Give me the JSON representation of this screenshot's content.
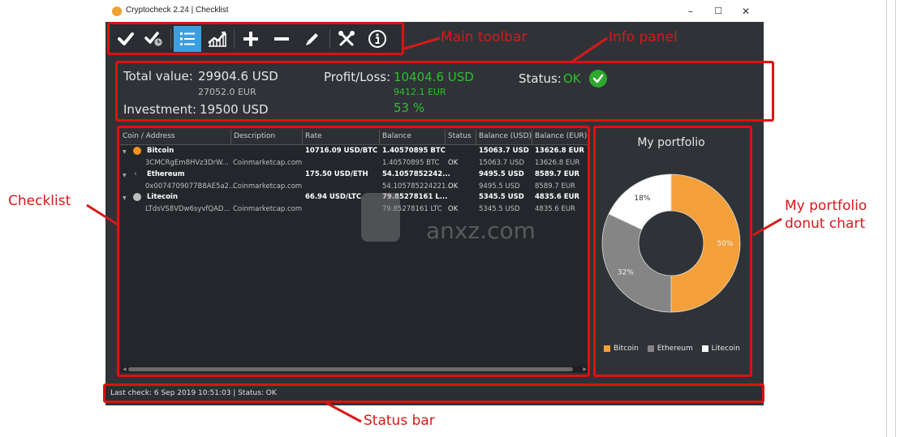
{
  "window": {
    "title": "Cryptocheck 2.24 | Checklist",
    "controls": {
      "minimize": "–",
      "maximize": "☐",
      "close": "✕"
    }
  },
  "toolbar": {
    "buttons": [
      {
        "name": "check",
        "icon": "checkmark-icon",
        "active": false
      },
      {
        "name": "scheduled-check",
        "icon": "check-clock-icon",
        "active": false
      },
      {
        "name": "checklist",
        "icon": "list-icon",
        "active": true
      },
      {
        "name": "chart",
        "icon": "chart-growth-icon",
        "active": false
      },
      {
        "name": "add",
        "icon": "plus-icon",
        "active": false
      },
      {
        "name": "remove",
        "icon": "minus-icon",
        "active": false
      },
      {
        "name": "edit",
        "icon": "pencil-icon",
        "active": false
      },
      {
        "name": "settings",
        "icon": "tools-icon",
        "active": false
      },
      {
        "name": "about",
        "icon": "info-icon",
        "active": false
      }
    ]
  },
  "info_panel": {
    "total_value_label": "Total value:",
    "total_value_usd": "29904.6 USD",
    "total_value_eur": "27052.0 EUR",
    "investment_label": "Investment:",
    "investment_value": "19500 USD",
    "profit_label": "Profit/Loss:",
    "profit_usd": "10404.6 USD",
    "profit_eur": "9412.1 EUR",
    "profit_percent": "53 %",
    "status_label": "Status:",
    "status_value": "OK"
  },
  "checklist": {
    "columns": [
      "Coin / Address",
      "Description",
      "Rate",
      "Balance",
      "Status",
      "Balance (USD)",
      "Balance (EUR)"
    ],
    "rows": [
      {
        "coin": "Bitcoin",
        "icon": "bitcoin-icon",
        "color": "#f7931a",
        "address": "3CMCRgEm8HVz3DrW...",
        "description": "Coinmarketcap.com",
        "rate": "10716.09 USD/BTC",
        "balance": "1.40570895 BTC",
        "balance_sub": "1.40570895 BTC",
        "status": "OK",
        "usd": "15063.7 USD",
        "usd_sub": "15063.7 USD",
        "eur": "13626.8 EUR",
        "eur_sub": "13626.8 EUR"
      },
      {
        "coin": "Ethereum",
        "icon": "ethereum-icon",
        "color": "#8c8c8c",
        "address": "0x0074709077B8AE5a2...",
        "description": "Coinmarketcap.com",
        "rate": "175.50 USD/ETH",
        "balance": "54.1057852242...",
        "balance_sub": "54.105785224221...",
        "status": "OK",
        "usd": "9495.5 USD",
        "usd_sub": "9495.5 USD",
        "eur": "8589.7 EUR",
        "eur_sub": "8589.7 EUR"
      },
      {
        "coin": "Litecoin",
        "icon": "litecoin-icon",
        "color": "#bdbdbd",
        "address": "LTdsVS8VDw6syvfQAD...",
        "description": "Coinmarketcap.com",
        "rate": "66.94 USD/LTC",
        "balance": "79.85278161 L...",
        "balance_sub": "79.85278161 LTC",
        "status": "OK",
        "usd": "5345.5 USD",
        "usd_sub": "5345.5 USD",
        "eur": "4835.6 EUR",
        "eur_sub": "4835.6 EUR"
      }
    ]
  },
  "chart_data": {
    "type": "pie",
    "title": "My portfolio",
    "categories": [
      "Bitcoin",
      "Ethereum",
      "Litecoin"
    ],
    "values": [
      50,
      32,
      18
    ],
    "labels": [
      "50%",
      "32%",
      "18%"
    ],
    "colors": [
      "#f4a03a",
      "#858585",
      "#ffffff"
    ],
    "donut": true,
    "legend": "bottom"
  },
  "status_bar": {
    "text": "Last check: 6 Sep 2019 10:51:03  |  Status: OK"
  },
  "annotations": {
    "main_toolbar": "Main toolbar",
    "info_panel": "Info panel",
    "checklist": "Checklist",
    "portfolio_line1": "My portfolio",
    "portfolio_line2": "donut chart",
    "status_bar": "Status bar"
  },
  "watermark": {
    "text": "anxz.com"
  }
}
